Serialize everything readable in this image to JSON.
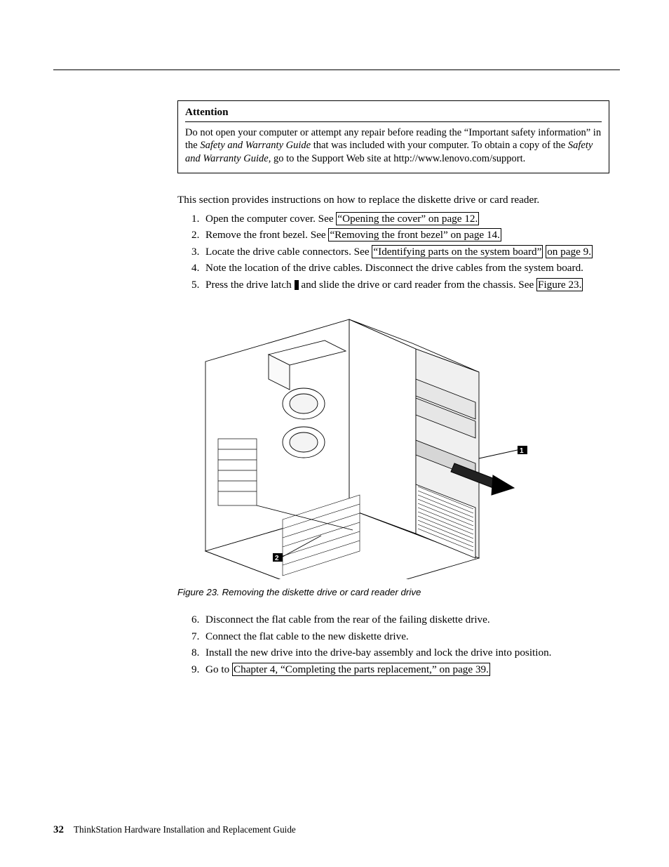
{
  "callout": {
    "title": "Attention",
    "body_before_italic1": "Do not open your computer or attempt any repair before reading the “Important safety information” in the ",
    "italic1": "Safety and Warranty Guide",
    "body_mid": " that was included with your computer. To obtain a copy of the ",
    "italic2": "Safety and Warranty Guide",
    "body_after": ", go to the Support Web site at http://www.lenovo.com/support."
  },
  "intro": "This section provides instructions on how to replace the diskette drive or card reader.",
  "steps1": {
    "s1": {
      "num": "1.",
      "text_before": "Open the computer cover. See ",
      "link": "“Opening the cover” on page 12."
    },
    "s2": {
      "num": "2.",
      "text_before": "Remove the front bezel. See ",
      "link": "“Removing the front bezel” on page 14."
    },
    "s3": {
      "num": "3.",
      "text_before": "Locate the drive cable connectors. See ",
      "link_part1": "“Identifying parts on the system board”",
      "link_part2": "on page 9."
    },
    "s4": {
      "num": "4.",
      "text": "Note the location of the drive cables. Disconnect the drive cables from the system board."
    },
    "s5": {
      "num": "5.",
      "text_before": "Press the drive latch ",
      "callnum": "1",
      "text_mid": " and slide the drive or card reader from the chassis. See ",
      "link": "Figure 23."
    }
  },
  "figure": {
    "caption": "Figure 23. Removing the diskette drive or card reader drive",
    "callouts": {
      "c1": "1",
      "c2": "2"
    }
  },
  "steps2": {
    "s6": {
      "num": "6.",
      "text": "Disconnect the flat cable from the rear of the failing diskette drive."
    },
    "s7": {
      "num": "7.",
      "text": "Connect the flat cable to the new diskette drive."
    },
    "s8": {
      "num": "8.",
      "text": "Install the new drive into the drive-bay assembly and lock the drive into position."
    },
    "s9": {
      "num": "9.",
      "text_before": "Go to ",
      "link": "Chapter 4, “Completing the parts replacement,” on page 39."
    }
  },
  "footer": {
    "page": "32",
    "doc_title": "ThinkStation Hardware Installation and Replacement Guide"
  }
}
